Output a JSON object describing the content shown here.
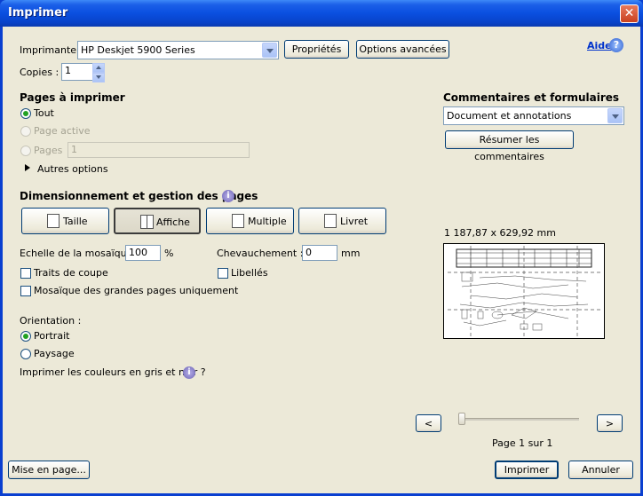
{
  "window": {
    "title": "Imprimer",
    "close_glyph": "✕"
  },
  "printer": {
    "label": "Imprimante :",
    "value": "HP Deskjet 5900 Series",
    "properties_button": "Propriétés",
    "advanced_button": "Options avancées",
    "help_link": "Aide",
    "help_glyph": "?"
  },
  "copies": {
    "label": "Copies :",
    "value": "1"
  },
  "pages": {
    "heading": "Pages à imprimer",
    "options": [
      {
        "label": "Tout",
        "selected": true,
        "enabled": true
      },
      {
        "label": "Page active",
        "selected": false,
        "enabled": false
      },
      {
        "label": "Pages",
        "selected": false,
        "enabled": false
      }
    ],
    "range_value": "1",
    "more_options": "Autres options"
  },
  "comments": {
    "heading": "Commentaires et formulaires",
    "selected": "Document et annotations",
    "summarize_button": "Résumer les commentaires"
  },
  "sizing": {
    "heading": "Dimensionnement et gestion des pages",
    "info_glyph": "i",
    "tabs": [
      {
        "label": "Taille",
        "icon": "page-size-icon"
      },
      {
        "label": "Affiche",
        "icon": "poster-icon",
        "selected": true
      },
      {
        "label": "Multiple",
        "icon": "multiple-pages-icon"
      },
      {
        "label": "Livret",
        "icon": "booklet-icon"
      }
    ],
    "tile_scale_label": "Echelle de la mosaïque :",
    "tile_scale_value": "100",
    "tile_scale_unit": "%",
    "overlap_label": "Chevauchement :",
    "overlap_value": "0",
    "overlap_unit": "mm",
    "cut_marks": "Traits de coupe",
    "labels": "Libellés",
    "tile_large_only": "Mosaïque des grandes pages uniquement"
  },
  "orientation": {
    "label": "Orientation :",
    "options": [
      {
        "label": "Portrait",
        "selected": true
      },
      {
        "label": "Paysage",
        "selected": false
      }
    ]
  },
  "grayscale": {
    "label": "Imprimer les couleurs en gris et noir ?"
  },
  "preview": {
    "dimensions": "1 187,87 x 629,92 mm",
    "prev": "<",
    "next": ">",
    "page_status": "Page 1 sur 1"
  },
  "footer": {
    "page_setup_button": "Mise en page...",
    "print_button": "Imprimer",
    "cancel_button": "Annuler"
  }
}
